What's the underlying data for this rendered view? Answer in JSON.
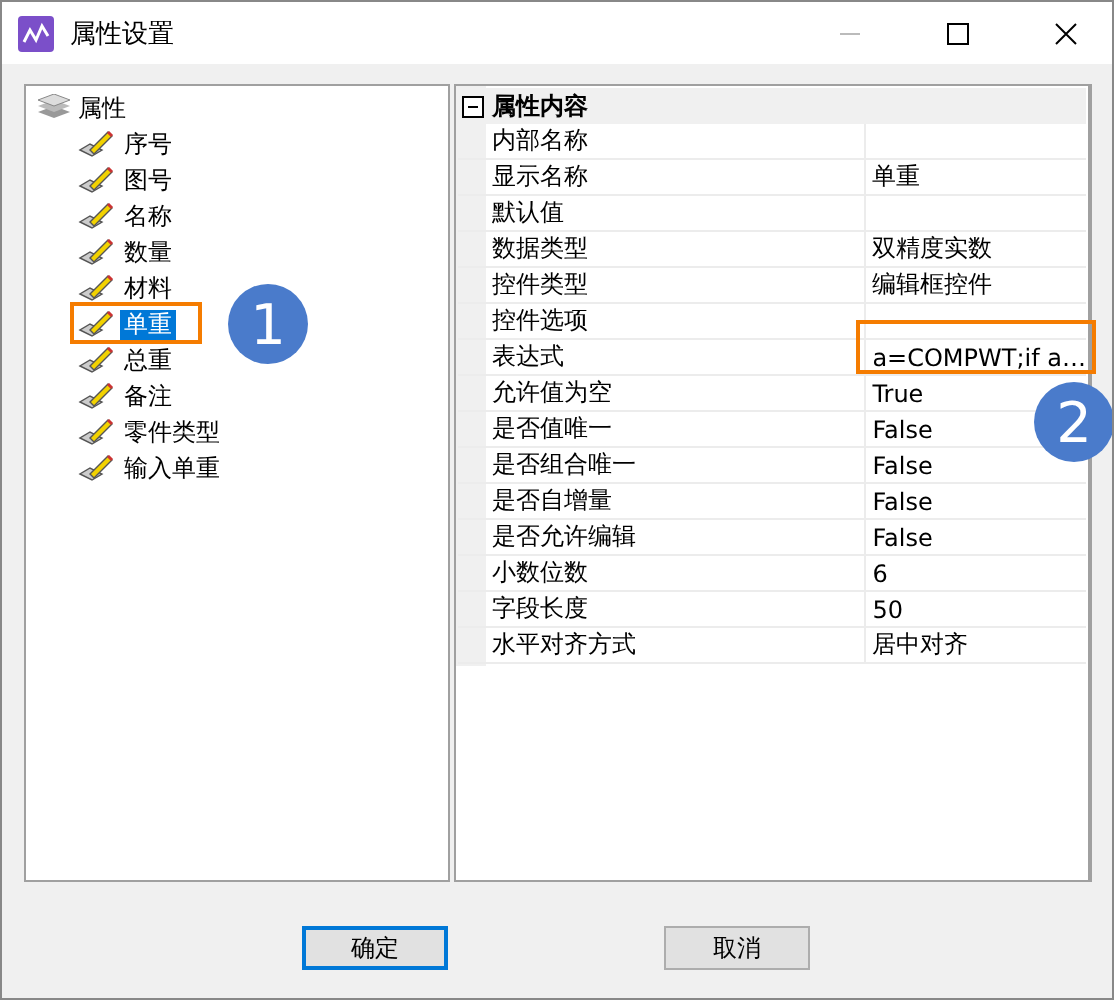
{
  "window": {
    "title": "属性设置"
  },
  "tree": {
    "label": "属性",
    "expanded": true,
    "children": [
      {
        "label": "序号",
        "selected": false
      },
      {
        "label": "图号",
        "selected": false
      },
      {
        "label": "名称",
        "selected": false
      },
      {
        "label": "数量",
        "selected": false
      },
      {
        "label": "材料",
        "selected": false
      },
      {
        "label": "单重",
        "selected": true
      },
      {
        "label": "总重",
        "selected": false
      },
      {
        "label": "备注",
        "selected": false
      },
      {
        "label": "零件类型",
        "selected": false
      },
      {
        "label": "输入单重",
        "selected": false
      }
    ]
  },
  "property_grid": {
    "group": "属性内容",
    "expanded": true,
    "rows": [
      {
        "name": "内部名称",
        "value": ""
      },
      {
        "name": "显示名称",
        "value": "单重"
      },
      {
        "name": "默认值",
        "value": ""
      },
      {
        "name": "数据类型",
        "value": "双精度实数"
      },
      {
        "name": "控件类型",
        "value": "编辑框控件"
      },
      {
        "name": "控件选项",
        "value": ""
      },
      {
        "name": "表达式",
        "value": "a=COMPWT;if a…"
      },
      {
        "name": "允许值为空",
        "value": "True"
      },
      {
        "name": "是否值唯一",
        "value": "False"
      },
      {
        "name": "是否组合唯一",
        "value": "False"
      },
      {
        "name": "是否自增量",
        "value": "False"
      },
      {
        "name": "是否允许编辑",
        "value": "False"
      },
      {
        "name": "小数位数",
        "value": "6"
      },
      {
        "name": "字段长度",
        "value": "50"
      },
      {
        "name": "水平对齐方式",
        "value": "居中对齐"
      }
    ]
  },
  "buttons": [
    {
      "label": "确定",
      "default": true
    },
    {
      "label": "取消",
      "default": false
    }
  ],
  "callouts": [
    {
      "number": "1"
    },
    {
      "number": "2"
    }
  ]
}
